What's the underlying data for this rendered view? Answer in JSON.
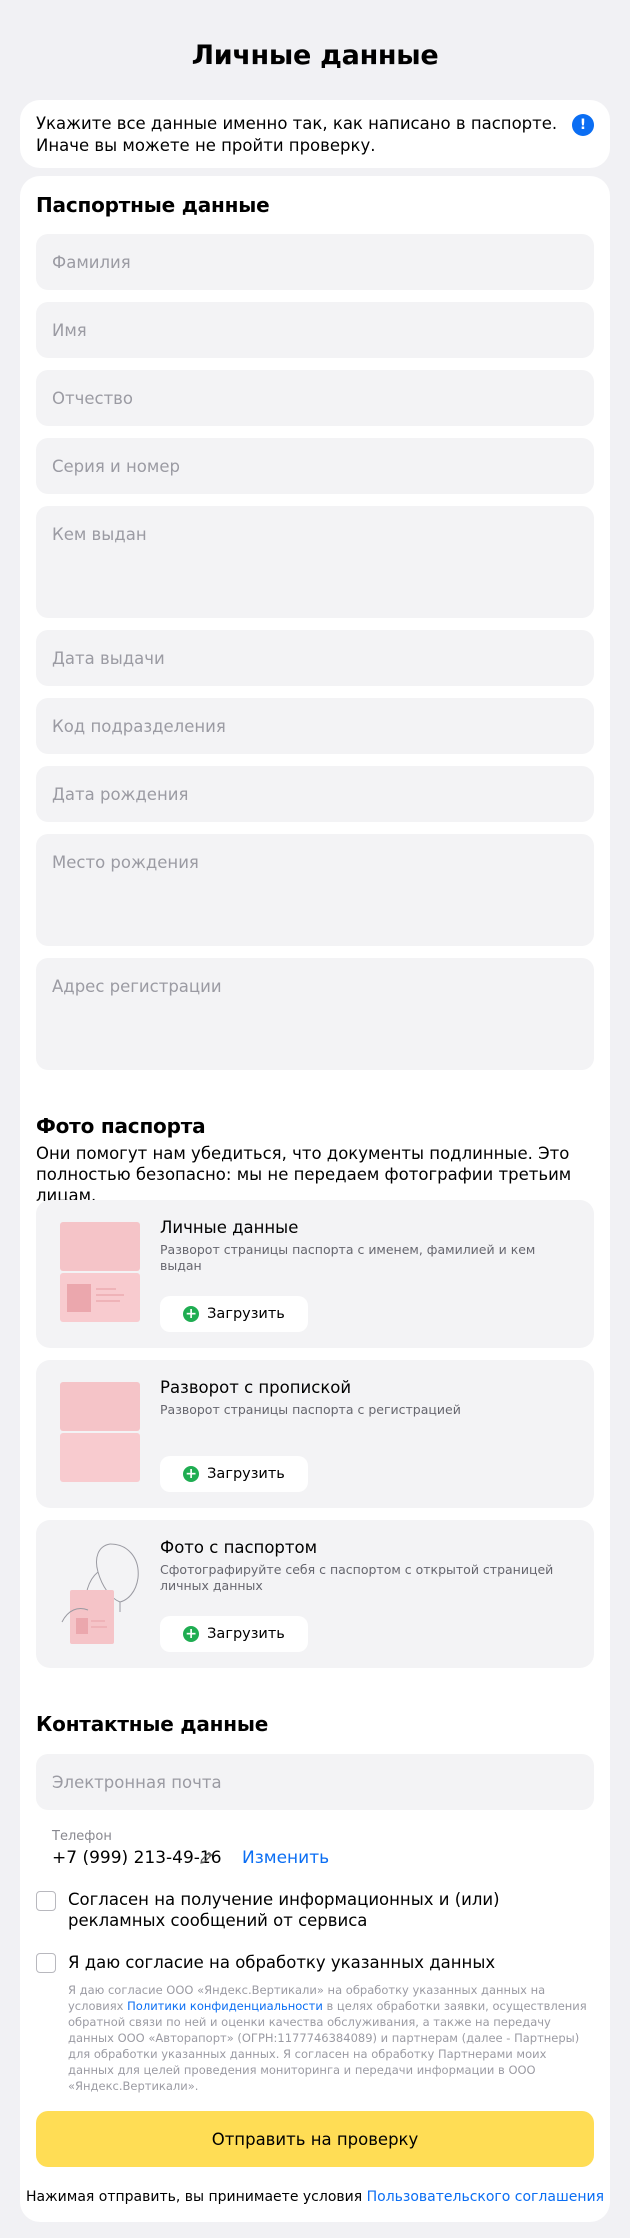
{
  "page_title": "Личные данные",
  "notice": {
    "text": "Укажите все данные именно так, как написано в паспорте. Иначе вы можете не пройти проверку.",
    "icon": "info-icon"
  },
  "passport_section": {
    "title": "Паспортные данные",
    "fields": {
      "surname": "Фамилия",
      "name": "Имя",
      "patronymic": "Отчество",
      "series_number": "Серия и номер",
      "issued_by": "Кем выдан",
      "issue_date": "Дата выдачи",
      "department_code": "Код подразделения",
      "birth_date": "Дата рождения",
      "birth_place": "Место рождения",
      "registration_address": "Адрес регистрации"
    }
  },
  "photo_section": {
    "title": "Фото паспорта",
    "description": "Они помогут нам убедиться, что документы подлинные. Это полностью безопасно: мы не передаем фотографии третьим лицам.",
    "cards": [
      {
        "title": "Личные данные",
        "subtitle": "Разворот страницы паспорта с именем, фамилией и кем выдан",
        "button": "Загрузить"
      },
      {
        "title": "Разворот с пропиской",
        "subtitle": "Разворот страницы паспорта с регистрацией",
        "button": "Загрузить"
      },
      {
        "title": "Фото с паспортом",
        "subtitle": "Сфотографируйте себя с паспортом с открытой страницей личных данных",
        "button": "Загрузить"
      }
    ]
  },
  "contact_section": {
    "title": "Контактные данные",
    "email_placeholder": "Электронная почта",
    "phone_label": "Телефон",
    "phone_value": "+7 (999) 213-49-16",
    "change_link": "Изменить"
  },
  "consents": {
    "marketing": "Согласен на получение информационных и (или) рекламных сообщений от сервиса",
    "processing": "Я даю согласие на обработку указанных данных",
    "details_before": "Я даю согласие ООО «Яндекс.Вертикали» на обработку указанных данных на условиях",
    "details_link": "Политики конфиденциальности",
    "details_after": "в целях обработки заявки, осуществления обратной связи по ней и оценки качества обслуживания, а также на передачу данных ООО «Авторапорт» (ОГРН:1177746384089) и партнерам (далее - Партнеры) для обработки указанных данных. Я согласен на обработку Партнерами моих данных для целей проведения мониторинга и передачи информации в ООО «Яндекс.Вертикали»."
  },
  "submit_button": "Отправить на проверку",
  "terms": {
    "prefix": "Нажимая отправить, вы принимаете условия",
    "link": "Пользовательского соглашения"
  },
  "colors": {
    "accent_blue": "#0b6ef3",
    "submit_yellow": "#ffdd55",
    "upload_green": "#1fad52",
    "background": "#f1f1f4"
  }
}
